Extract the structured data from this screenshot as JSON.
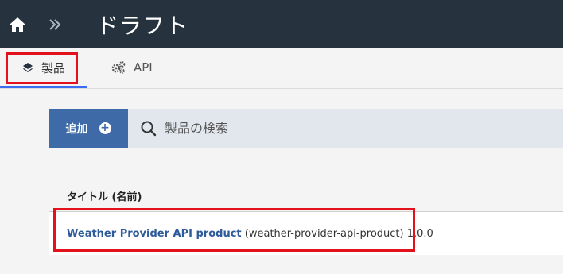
{
  "header": {
    "title": "ドラフト",
    "home_icon": "home-icon",
    "expand_icon": "double-chevron-right-icon"
  },
  "tabs": [
    {
      "label": "製品",
      "icon": "layers-icon",
      "active": true
    },
    {
      "label": "API",
      "icon": "gears-icon",
      "active": false
    }
  ],
  "toolbar": {
    "add_label": "追加",
    "add_icon": "plus-circle-icon",
    "search_placeholder": "製品の検索",
    "search_icon": "search-icon"
  },
  "table": {
    "column_header": "タイトル (名前)",
    "rows": [
      {
        "title": "Weather Provider API product",
        "meta": "(weather-provider-api-product) 1.0.0"
      }
    ]
  },
  "colors": {
    "header_bg": "#26333f",
    "accent": "#3c6df0",
    "add_button": "#3e6aa8",
    "highlight": "#e3111c",
    "link": "#2e5b9a"
  }
}
